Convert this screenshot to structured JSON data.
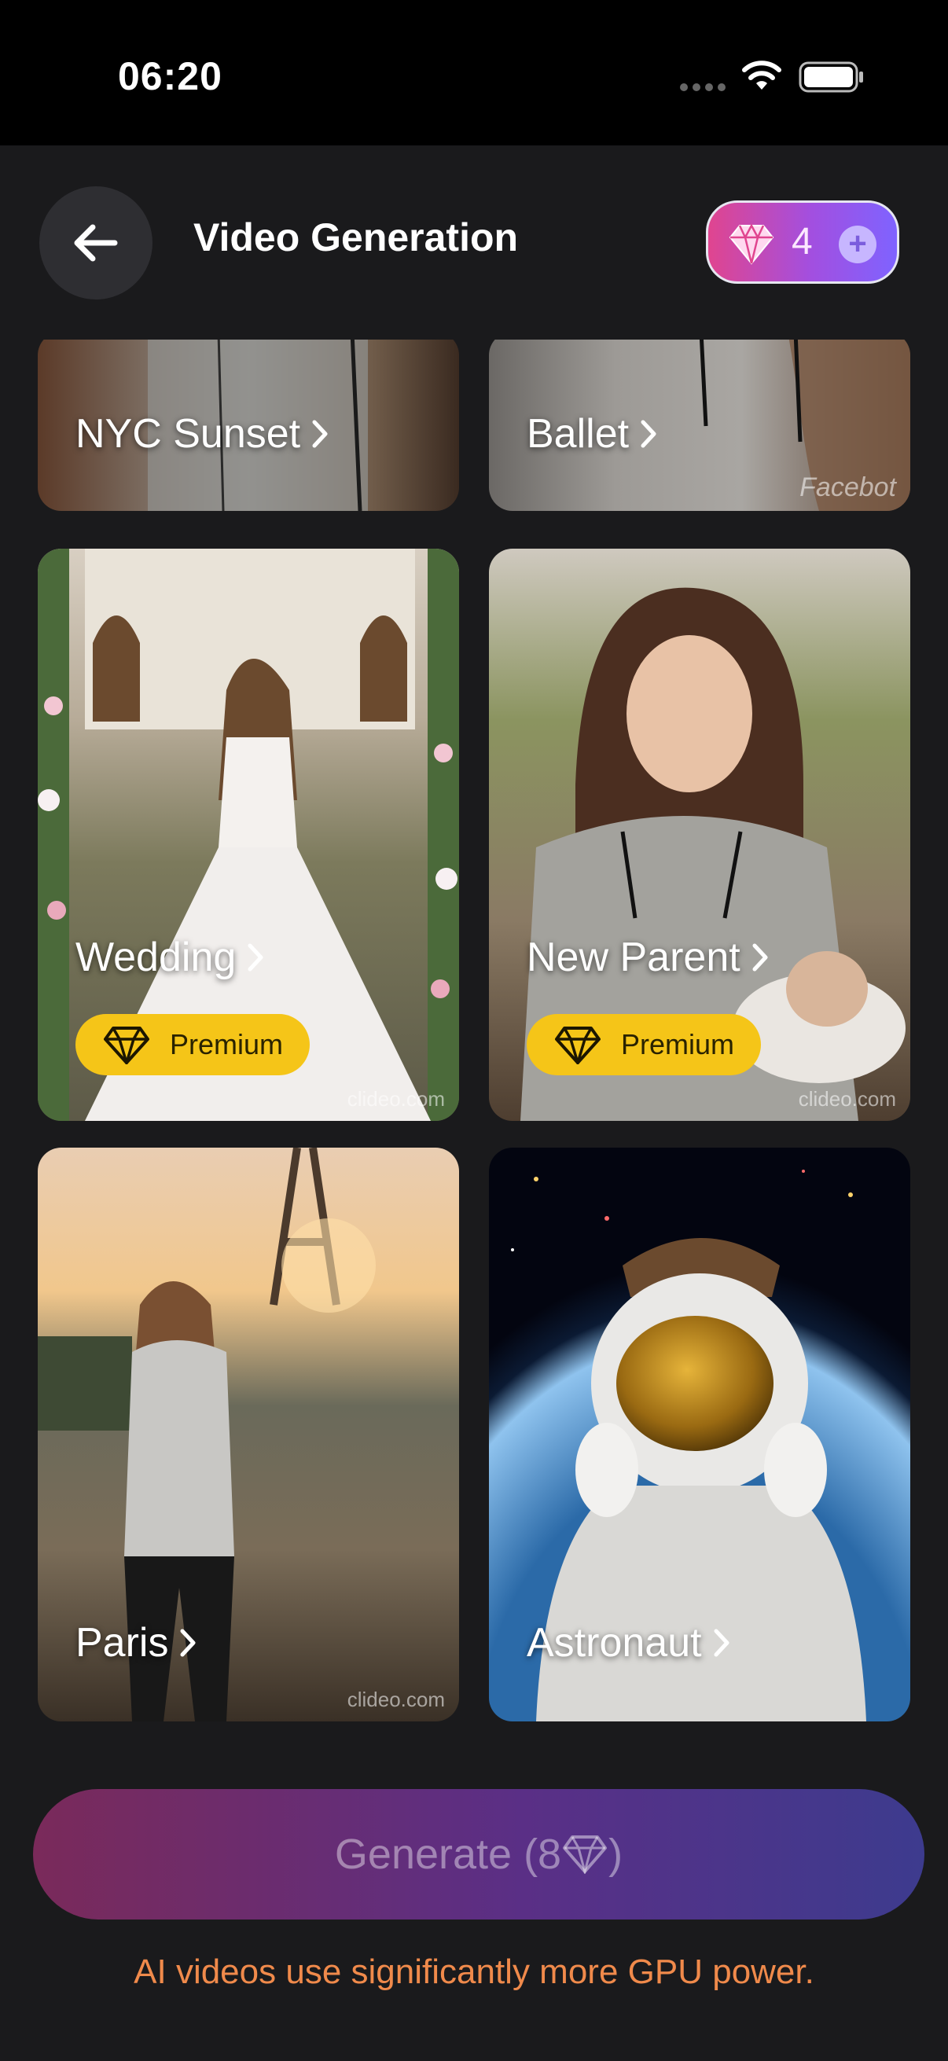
{
  "status": {
    "time": "06:20"
  },
  "header": {
    "title": "Video Generation",
    "credits": "4",
    "plus": "+"
  },
  "cards": [
    {
      "label": "NYC Sunset",
      "premium": false
    },
    {
      "label": "Ballet",
      "premium": false,
      "watermark": "Facebot"
    },
    {
      "label": "Wedding",
      "premium": true,
      "watermark": "clideo.com"
    },
    {
      "label": "New Parent",
      "premium": true,
      "watermark": "clideo.com"
    },
    {
      "label": "Paris",
      "premium": false,
      "watermark": "clideo.com"
    },
    {
      "label": "Astronaut",
      "premium": false
    }
  ],
  "premium_label": "Premium",
  "generate": {
    "prefix": "Generate (8",
    "suffix": ")"
  },
  "notice": "AI videos use significantly more GPU power.",
  "colors": {
    "background": "#1a1a1c",
    "premium": "#f5c518",
    "notice": "#f08a4b",
    "credits_gradient_start": "#e0458f",
    "credits_gradient_end": "#7f63ff"
  }
}
